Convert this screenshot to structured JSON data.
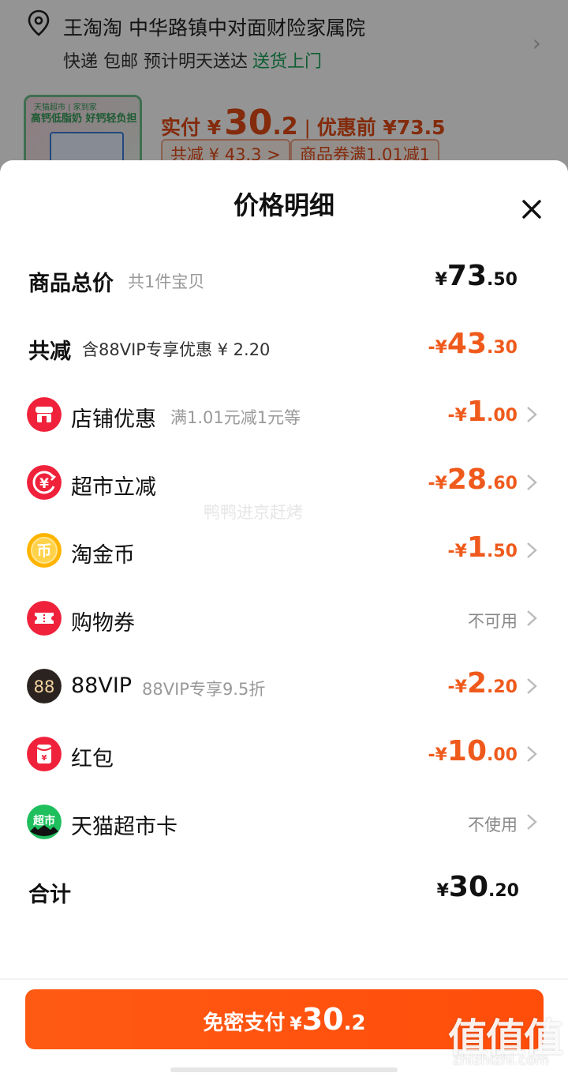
{
  "background": {
    "address_name": "王淘淘  中华路镇中对面财险家属院",
    "delivery_text": "快递 包邮 预计明天送达",
    "delivery_highlight": "送货上门",
    "product_thumb_line1": "天猫超市 | 家到家",
    "product_thumb_line2": "高钙低脂奶 好钙轻负担",
    "paid_label": "实付 ¥",
    "paid_int": "30",
    "paid_dec": ".2",
    "pre_discount": "优惠前 ¥73.5",
    "tag_total_cut": "共减 ¥ 43.3 >",
    "tag_coupon": "商品券满1.01减1"
  },
  "sheet": {
    "title": "价格明细",
    "rows": {
      "subtotal": {
        "label": "商品总价",
        "sub": "共1件宝贝",
        "yen": "¥",
        "int": "73",
        "dec": ".50"
      },
      "total_cut": {
        "label": "共减",
        "sub": "含88VIP专享优惠 ¥ 2.20",
        "yen": "-¥",
        "int": "43",
        "dec": ".30"
      },
      "shop": {
        "label": "店铺优惠",
        "sub": "满1.01元减1元等",
        "yen": "-¥",
        "int": "1",
        "dec": ".00"
      },
      "market": {
        "label": "超市立减",
        "yen": "-¥",
        "int": "28",
        "dec": ".60"
      },
      "coin": {
        "label": "淘金币",
        "yen": "-¥",
        "int": "1",
        "dec": ".50"
      },
      "voucher": {
        "label": "购物券",
        "status": "不可用"
      },
      "vip": {
        "label": "88VIP",
        "sub": "88VIP专享9.5折",
        "yen": "-¥",
        "int": "2",
        "dec": ".20"
      },
      "redpack": {
        "label": "红包",
        "yen": "-¥",
        "int": "10",
        "dec": ".00"
      },
      "card": {
        "label": "天猫超市卡",
        "status": "不使用"
      },
      "total": {
        "label": "合计",
        "yen": "¥",
        "int": "30",
        "dec": ".20"
      }
    },
    "pay_button": {
      "text": "免密支付",
      "yen": "¥",
      "int": "30",
      "dec": ".2"
    }
  },
  "icons": {
    "shop": "shop-icon",
    "market": "yen-arrow-icon",
    "coin": "coin-icon",
    "voucher": "ticket-icon",
    "vip_badge": "88",
    "redpack": "red-envelope-icon",
    "card_badge": "超市"
  },
  "watermarks": {
    "center": "鸭鸭进京赶烤",
    "logo": "值值值",
    "url": "zhizhizhi.com"
  },
  "colors": {
    "accent": "#ef5a1c",
    "button": "#ff5010",
    "green": "#1aa35a"
  }
}
